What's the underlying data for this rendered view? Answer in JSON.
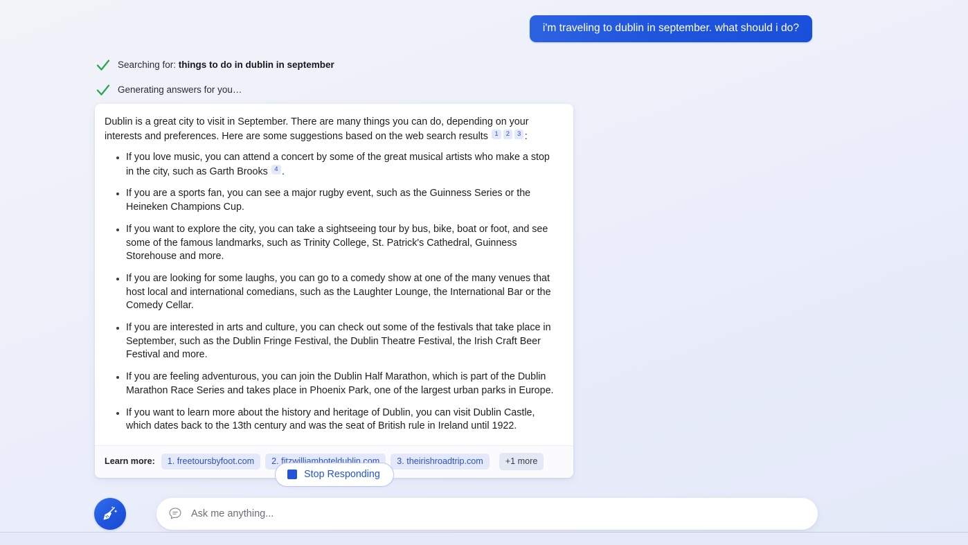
{
  "conversation": {
    "user_message": "i'm traveling to dublin in september. what should i do?"
  },
  "status": {
    "search_prefix": "Searching for: ",
    "search_query": "things to do in dublin in september",
    "generating": "Generating answers for you…"
  },
  "answer": {
    "intro_part1": "Dublin is a great city to visit in September. There are many things you can do, depending on your interests and preferences. Here are some suggestions based on the web search results ",
    "intro_citations": [
      "1",
      "2",
      "3"
    ],
    "intro_part2": ":",
    "bullets": [
      {
        "text_before": "If you love music, you can attend a concert by some of the great musical artists who make a stop in the city, such as Garth Brooks ",
        "citation": "4",
        "text_after": "."
      },
      {
        "text_before": "If you are a sports fan, you can see a major rugby event, such as the Guinness Series or the Heineken Champions Cup.",
        "citation": "",
        "text_after": ""
      },
      {
        "text_before": "If you want to explore the city, you can take a sightseeing tour by bus, bike, boat or foot, and see some of the famous landmarks, such as Trinity College, St. Patrick's Cathedral, Guinness Storehouse and more.",
        "citation": "",
        "text_after": ""
      },
      {
        "text_before": "If you are looking for some laughs, you can go to a comedy show at one of the many venues that host local and international comedians, such as the Laughter Lounge, the International Bar or the Comedy Cellar.",
        "citation": "",
        "text_after": ""
      },
      {
        "text_before": "If you are interested in arts and culture, you can check out some of the festivals that take place in September, such as the Dublin Fringe Festival, the Dublin Theatre Festival, the Irish Craft Beer Festival and more.",
        "citation": "",
        "text_after": ""
      },
      {
        "text_before": "If you are feeling adventurous, you can join the Dublin Half Marathon, which is part of the Dublin Marathon Race Series and takes place in Phoenix Park, one of the largest urban parks in Europe.",
        "citation": "",
        "text_after": ""
      },
      {
        "text_before": "If you want to learn more about the history and heritage of Dublin, you can visit Dublin Castle, which dates back to the 13th century and was the seat of British rule in Ireland until 1922.",
        "citation": "",
        "text_after": ""
      }
    ]
  },
  "learn_more": {
    "label": "Learn more:",
    "sources": [
      "1. freetoursbyfoot.com",
      "2. fitzwilliamhoteldublin.com",
      "3. theirishroadtrip.com"
    ],
    "more_label": "+1 more"
  },
  "stop_button": {
    "label": "Stop Responding",
    "icon": "stop-square-icon"
  },
  "composer": {
    "avatar_icon": "broom-sparkle-icon",
    "bubble_icon": "chat-bubble-icon",
    "placeholder": "Ask me anything..."
  },
  "colors": {
    "accent_blue": "#2154d8",
    "user_bubble_blue": "#1f54dd",
    "check_green": "#2ea44f",
    "citation_bg": "#e3e9fb",
    "chip_bg": "#e3e8fa"
  }
}
